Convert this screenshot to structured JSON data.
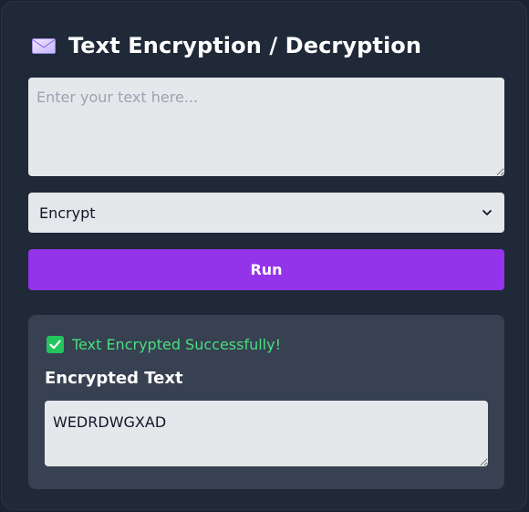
{
  "header": {
    "title": "Text Encryption / Decryption",
    "icon": "envelope-icon"
  },
  "input": {
    "placeholder": "Enter your text here...",
    "value": ""
  },
  "mode": {
    "selected": "Encrypt",
    "icon": "chevron-down-icon"
  },
  "run_button": {
    "label": "Run",
    "color": "#9333ea"
  },
  "result": {
    "status_icon": "check-mark-icon",
    "status": "Text Encrypted Successfully!",
    "status_color": "#4ade80",
    "label": "Encrypted Text",
    "value": "WEDRDWGXAD"
  }
}
